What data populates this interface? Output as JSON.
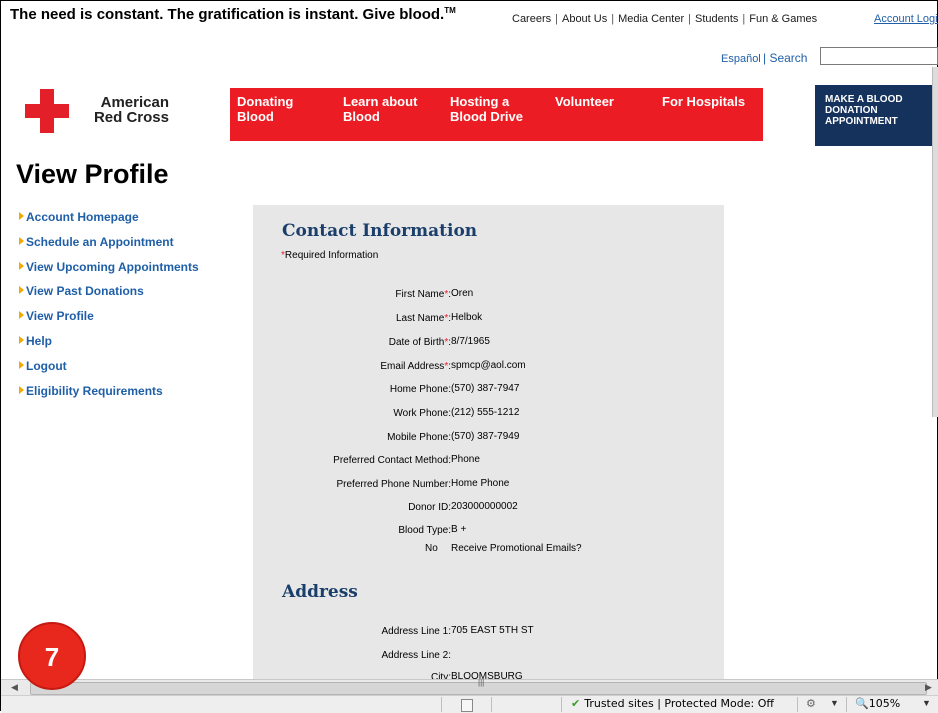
{
  "tagline": "The need is constant. The gratification is instant. Give blood.",
  "tagline_tm": "TM",
  "top_links": [
    "Careers",
    "About Us",
    "Media Center",
    "Students",
    "Fun & Games"
  ],
  "account_login": "Account Login",
  "espanol": "Español",
  "search_label": "| Search",
  "search_value": "",
  "logo": {
    "line1": "American",
    "line2": "Red Cross"
  },
  "nav": [
    {
      "l1": "Donating",
      "l2": "Blood"
    },
    {
      "l1": "Learn about",
      "l2": "Blood"
    },
    {
      "l1": "Hosting a",
      "l2": "Blood Drive"
    },
    {
      "l1": "Volunteer",
      "l2": ""
    },
    {
      "l1": "For Hospitals",
      "l2": ""
    }
  ],
  "appointment_button": [
    "MAKE A BLOOD",
    "DONATION",
    "APPOINTMENT"
  ],
  "page_title": "View Profile",
  "sidebar": [
    "Account Homepage",
    "Schedule an Appointment",
    "View Upcoming Appointments",
    "View Past Donations",
    "View Profile",
    "Help",
    "Logout",
    "Eligibility Requirements"
  ],
  "contact": {
    "title": "Contact Information",
    "required_note": "Required Information",
    "fields": [
      {
        "label": "First Name",
        "required": true,
        "value": "Oren"
      },
      {
        "label": "Last Name",
        "required": true,
        "value": "Helbok"
      },
      {
        "label": "Date of Birth",
        "required": true,
        "value": "8/7/1965"
      },
      {
        "label": "Email Address",
        "required": true,
        "value": "spmcp@aol.com"
      },
      {
        "label": "Home Phone",
        "required": false,
        "value": "(570) 387-7947"
      },
      {
        "label": "Work Phone",
        "required": false,
        "value": "(212) 555-1212"
      },
      {
        "label": "Mobile Phone",
        "required": false,
        "value": "(570) 387-7949"
      },
      {
        "label": "Preferred Contact Method",
        "required": false,
        "value": "Phone"
      },
      {
        "label": "Preferred Phone Number",
        "required": false,
        "value": "Home Phone"
      },
      {
        "label": "Donor ID",
        "required": false,
        "value": "203000000002"
      },
      {
        "label": "Blood Type",
        "required": false,
        "value": "B +"
      }
    ],
    "promo": {
      "value": "No",
      "label": "Receive Promotional Emails?"
    }
  },
  "address": {
    "title": "Address",
    "fields": [
      {
        "label": "Address Line 1",
        "value": "705 EAST 5TH ST"
      },
      {
        "label": "Address Line 2",
        "value": ""
      },
      {
        "label": "City",
        "value": "BLOOMSBURG"
      }
    ]
  },
  "status_bar": {
    "zone": "Trusted sites | Protected Mode: Off",
    "zoom": "105%"
  },
  "badge": "7",
  "colors": {
    "red": "#ec1c24",
    "navy": "#14325c",
    "link": "#1f5fa8",
    "panel": "#e7e7e7"
  }
}
